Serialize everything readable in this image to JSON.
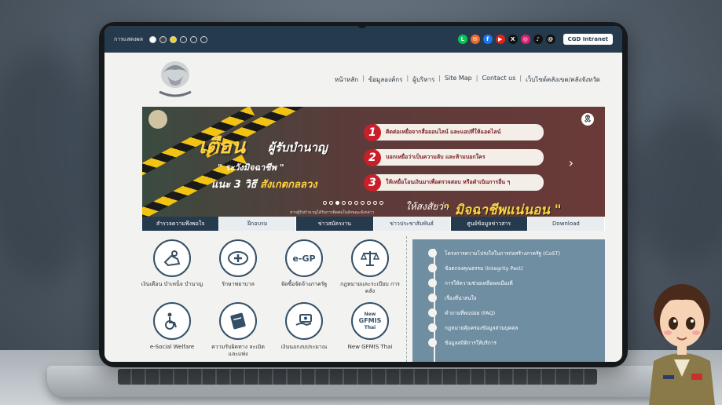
{
  "topbar": {
    "display_label": "การแสดงผล",
    "intranet_label": "CGD Intranet",
    "social_icons": [
      "line-icon",
      "mail-icon",
      "facebook-icon",
      "youtube-icon",
      "x-icon",
      "instagram-icon",
      "tiktok-icon",
      "threads-icon"
    ],
    "colors": {
      "bar": "#263a4d"
    }
  },
  "nav": {
    "items": [
      "หน้าหลัก",
      "ข้อมูลองค์กร",
      "ผู้บริหาร",
      "Site Map",
      "Contact us",
      "เว็บไซต์คลังเขต/คลังจังหวัด"
    ]
  },
  "banner": {
    "warning": "เตือน",
    "warning_target": "ผู้รับบำนาญ",
    "quote": "\" ระวังมิจฉาชีพ \"",
    "advice_prefix": "แนะ 3 วิธี",
    "advice_suffix": "สังเกตกลลวง",
    "steps": [
      {
        "num": "1",
        "text": "ติดต่อเหยื่อจากสื่อออนไลน์ และแอปที่ให้แอดไลน์"
      },
      {
        "num": "2",
        "text": "บอกเหยื่อว่าเป็นความลับ และห้ามบอกใคร"
      },
      {
        "num": "3",
        "text": "ให้เหยื่อโอนเงินมาเพื่อตรวจสอบ หรือดำเนินการอื่น ๆ"
      }
    ],
    "slogan_small": "ให้สงสัยว่า",
    "slogan": "\" มิจฉาชีพแน่นอน \"",
    "note": "หากผู้รับบำนาญได้รับการติดต่อในลักษณะดังกล่าว"
  },
  "tabs": [
    "สำรวจความพึงพอใจ",
    "ฝึกอบรม",
    "ข่าวสมัครงาน",
    "ข่าวประชาสัมพันธ์",
    "ศูนย์ข้อมูลข่าวสาร",
    "Download"
  ],
  "services": [
    {
      "label": "เงินเดือน บำเหน็จ บำนาญ",
      "icon": "hand-coins-icon"
    },
    {
      "label": "รักษาพยาบาล",
      "icon": "medical-icon"
    },
    {
      "label": "จัดซื้อจัดจ้างภาครัฐ",
      "icon": "egp-icon",
      "icon_text": "e-GP"
    },
    {
      "label": "กฎหมายและระเบียบ การคลัง",
      "icon": "scales-icon"
    },
    {
      "label": "e-Social Welfare",
      "icon": "welfare-icon"
    },
    {
      "label": "ความรับผิดทาง ละเมิดและแพ่ง",
      "icon": "book-icon"
    },
    {
      "label": "เงินนอกงบประมาณ",
      "icon": "money-hand-icon"
    },
    {
      "label": "New GFMIS Thai",
      "icon": "gfmis-icon",
      "icon_text": [
        "New",
        "GFMIS",
        "Thai"
      ]
    }
  ],
  "side_links": [
    "โครงการความโปร่งใสในการก่อสร้างภาครัฐ (CoST)",
    "ข้อตกลงคุณธรรม (Integrity Pact)",
    "การให้ความช่วยเหลือพลเมืองดี",
    "เรื่องที่น่าสนใจ",
    "คำถามที่พบบ่อย (FAQ)",
    "กฎหมายคุ้มครองข้อมูลส่วนบุคคล",
    "ข้อมูลสถิติการให้บริการ"
  ]
}
